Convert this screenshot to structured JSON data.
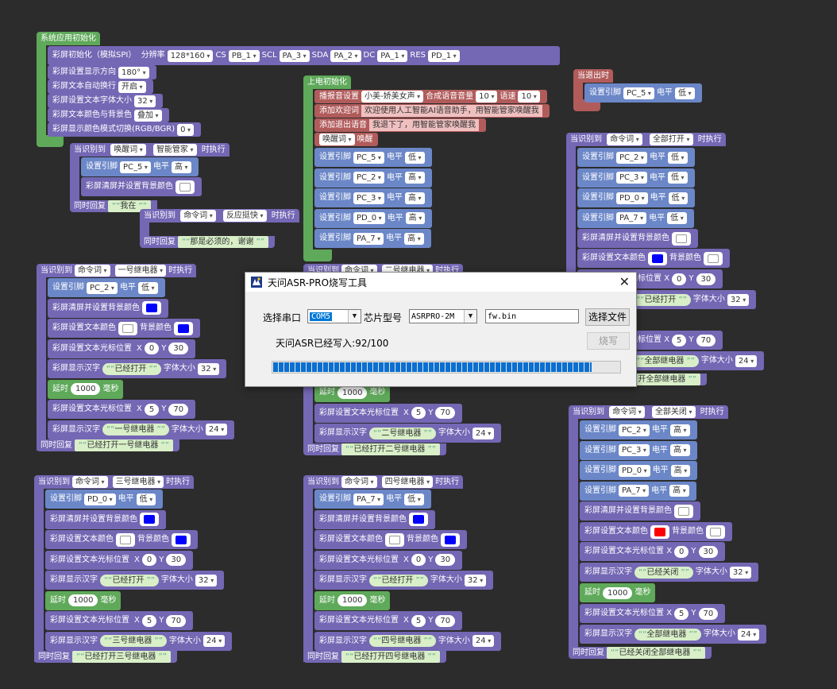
{
  "dialog": {
    "title": "天问ASR-PRO烧写工具",
    "port_label": "选择串口",
    "port_value": "COM5",
    "chip_label": "芯片型号",
    "chip_value": "ASRPRO-2M",
    "file_value": "fw.bin",
    "select_file_button": "选择文件",
    "burn_button": "烧写",
    "status_text": "天问ASR已经写入:92/100",
    "progress": 0.92,
    "close_glyph": "✕"
  },
  "blocks": {
    "sys_init": {
      "hat": "系统应用初始化",
      "lcd_init": "彩屏初始化（模拟SPI）",
      "res_label": "分辨率",
      "res_value": "128*160",
      "cs_label": "CS",
      "cs_value": "PB_1",
      "scl_label": "SCL",
      "scl_value": "PA_3",
      "sda_label": "SDA",
      "sda_value": "PA_2",
      "dc_label": "DC",
      "dc_value": "PA_1",
      "rst_label": "RES",
      "rst_value": "PD_1",
      "dir_label": "彩屏设置显示方向",
      "dir_value": "180°",
      "wrap_label": "彩屏文本自动换行",
      "wrap_value": "开启",
      "font_label": "彩屏设置文本字体大小",
      "font_value": "32",
      "color_label": "彩屏文本颜色与背景色",
      "color_value": "叠加",
      "mode_label": "彩屏显示颜色模式切换(RGB/BGR)",
      "mode_value": "0"
    },
    "power_init": {
      "hat": "上电初始化",
      "broadcast_label": "播报音设置",
      "broadcast_value": "小美-娇美女声",
      "vol_label": "合成语音音量",
      "vol_value": "10",
      "speed_label": "语速",
      "speed_value": "10",
      "welcome_label": "添加欢迎词",
      "welcome_value": "欢迎使用人工智能AI语音助手，用智能管家唤醒我",
      "exit_label": "添加退出语音",
      "exit_value": "我退下了，用智能管家唤醒我",
      "wake_dd": "唤醒词",
      "wake_label": "唤醒",
      "rows": [
        {
          "pin": "PC_5",
          "level": "低"
        },
        {
          "pin": "PC_2",
          "level": "高"
        },
        {
          "pin": "PC_3",
          "level": "高"
        },
        {
          "pin": "PD_0",
          "level": "高"
        },
        {
          "pin": "PA_7",
          "level": "高"
        }
      ]
    },
    "common": {
      "set_pin": "设置引脚",
      "level": "电平",
      "when": "当识别到",
      "exec": "时执行",
      "reply": "同时回复",
      "clear_bg": "彩屏清屏并设置背景颜色",
      "text_color": "彩屏设置文本颜色",
      "bg_color": "背景颜色",
      "cursor": "彩屏设置文本光标位置",
      "x": "X",
      "y": "Y",
      "show_cn": "彩屏显示汉字",
      "font_size": "字体大小",
      "delay": "延时",
      "ms": "毫秒",
      "cmd_word": "命令词"
    },
    "exit_block": {
      "hat": "当退出时",
      "pin": "PC_5",
      "level": "低"
    },
    "wake_block": {
      "keyword": "唤醒词",
      "word": "智能管家",
      "pin": "PC_5",
      "level": "高",
      "reply": "我在"
    },
    "react_block": {
      "word": "反应挺快",
      "reply": "那是必须的，谢谢"
    },
    "relay1": {
      "word": "一号继电器",
      "pin": "PC_2",
      "level": "低",
      "x1": "0",
      "y1": "30",
      "text1": "已经打开",
      "size1": "32",
      "delay": "1000",
      "x2": "5",
      "y2": "70",
      "text2": "一号继电器",
      "size2": "24",
      "reply": "已经打开一号继电器"
    },
    "relay2": {
      "word": "二号继电器",
      "delay": "1000",
      "x2": "5",
      "y2": "70",
      "text2": "二号继电器",
      "size2": "24",
      "reply": "已经打开二号继电器"
    },
    "relay3": {
      "word": "三号继电器",
      "pin": "PD_0",
      "level": "低",
      "x1": "0",
      "y1": "30",
      "text1": "已经打开",
      "size1": "32",
      "delay": "1000",
      "x2": "5",
      "y2": "70",
      "text2": "三号继电器",
      "size2": "24",
      "reply": "已经打开三号继电器"
    },
    "relay4": {
      "word": "四号继电器",
      "pin": "PA_7",
      "level": "低",
      "x1": "0",
      "y1": "30",
      "text1": "已经打开",
      "size1": "32",
      "delay": "1000",
      "x2": "5",
      "y2": "70",
      "text2": "四号继电器",
      "size2": "24",
      "reply": "已经打开四号继电器"
    },
    "all_on": {
      "word": "全部打开",
      "rows": [
        {
          "pin": "PC_2",
          "level": "低"
        },
        {
          "pin": "PC_3",
          "level": "低"
        },
        {
          "pin": "PD_0",
          "level": "低"
        },
        {
          "pin": "PA_7",
          "level": "低"
        }
      ],
      "x1": "0",
      "y1": "30",
      "text1": "已经打开",
      "size1": "32",
      "delay": "毫秒",
      "x2": "5",
      "y2": "70",
      "text2": "全部继电器",
      "size2": "24",
      "reply_tail": "开全部继电器"
    },
    "all_off": {
      "word": "全部关闭",
      "rows": [
        {
          "pin": "PC_2",
          "level": "高"
        },
        {
          "pin": "PC_3",
          "level": "高"
        },
        {
          "pin": "PD_0",
          "level": "高"
        },
        {
          "pin": "PA_7",
          "level": "高"
        }
      ],
      "x1": "0",
      "y1": "30",
      "text1": "已经关闭",
      "size1": "32",
      "delay": "1000",
      "x2": "5",
      "y2": "70",
      "text2": "全部继电器",
      "size2": "24",
      "reply": "已经关闭全部继电器"
    },
    "colors": {
      "purple": "#7467b4",
      "green": "#5fa95a",
      "red": "#b15b5b",
      "blue_block": "#6b87c8",
      "swatch_blue": "#0000ff",
      "swatch_white": "#ffffff",
      "swatch_red": "#ff0000"
    }
  }
}
